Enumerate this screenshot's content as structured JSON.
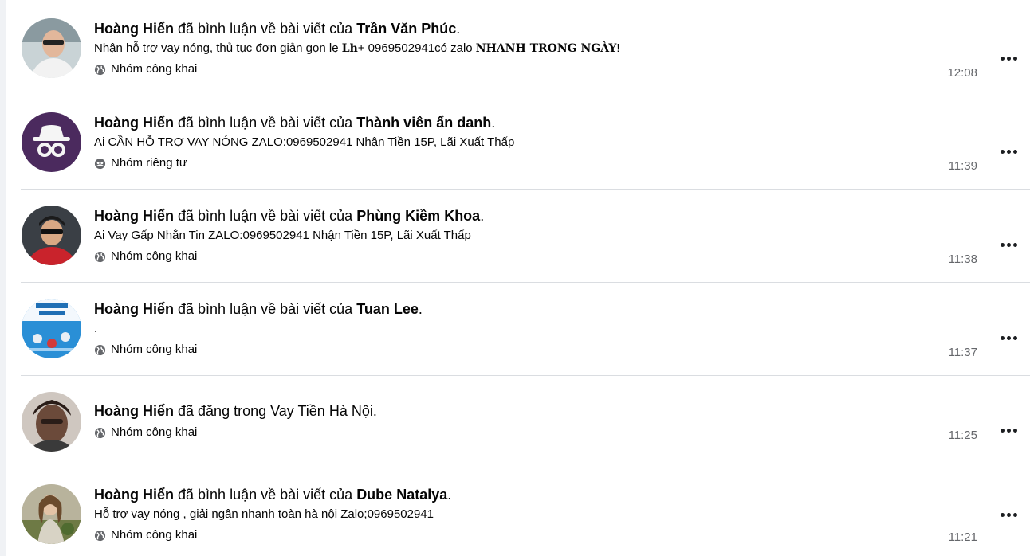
{
  "activity_items": [
    {
      "actor": "Hoàng Hiển",
      "action": " đã bình luận về bài viết của ",
      "target": "Trần Văn Phúc",
      "end": ".",
      "preview": {
        "a": "Nhận hỗ trợ vay nóng, thủ tục đơn giản gọn lẹ ",
        "b": "Lh",
        "c": "+ 0969502941có zalo ",
        "d": "NHANH TRONG NGÀY",
        "e": "!"
      },
      "privacy": "Nhóm công khai",
      "privacy_icon": "globe-icon",
      "time": "12:08"
    },
    {
      "actor": "Hoàng Hiển",
      "action": " đã bình luận về bài viết của ",
      "target": "Thành viên ẩn danh",
      "end": ".",
      "preview": "Ai CẦN HỖ TRỢ VAY NÓNG ZALO:0969502941 Nhận Tiền 15P, Lãi Xuất Thấp",
      "privacy": "Nhóm riêng tư",
      "privacy_icon": "private-group-icon",
      "time": "11:39"
    },
    {
      "actor": "Hoàng Hiển",
      "action": " đã bình luận về bài viết của ",
      "target": "Phùng Kiềm Khoa",
      "end": ".",
      "preview": "Ai Vay Gấp Nhắn Tin ZALO:0969502941 Nhận Tiền 15P, Lãi Xuất Thấp",
      "privacy": "Nhóm công khai",
      "privacy_icon": "globe-icon",
      "time": "11:38"
    },
    {
      "actor": "Hoàng Hiển",
      "action": " đã bình luận về bài viết của ",
      "target": "Tuan Lee",
      "end": ".",
      "preview": ".",
      "privacy": "Nhóm công khai",
      "privacy_icon": "globe-icon",
      "time": "11:37"
    },
    {
      "actor": "Hoàng Hiển",
      "action": " đã đăng trong Vay Tiền Hà Nội.",
      "privacy": "Nhóm công khai",
      "privacy_icon": "globe-icon",
      "time": "11:25"
    },
    {
      "actor": "Hoàng Hiển",
      "action": " đã bình luận về bài viết của ",
      "target": "Dube Natalya",
      "end": ".",
      "preview": "Hỗ trợ vay nóng , giải ngân nhanh toàn hà nội Zalo;0969502941",
      "privacy": "Nhóm công khai",
      "privacy_icon": "globe-icon",
      "time": "11:21"
    }
  ],
  "colors": {
    "divider": "#dadde1",
    "secondary_text": "#65676b",
    "anon_avatar_bg": "#4b2a5e"
  }
}
